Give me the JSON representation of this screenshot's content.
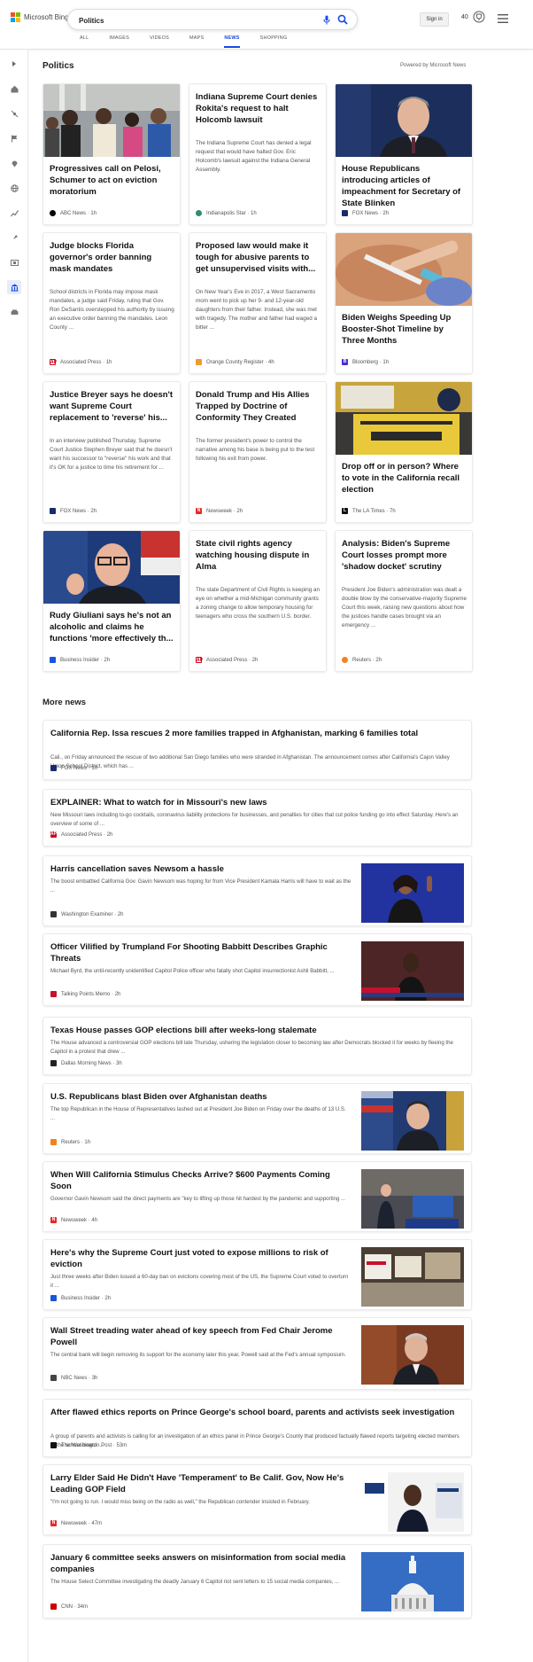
{
  "header": {
    "brand": "Microsoft Bing",
    "brand_colors": [
      "#f25022",
      "#7fba00",
      "#00a4ef",
      "#ffb900"
    ],
    "search_value": "Politics",
    "signin_label": "Sign in",
    "rewards_count": "40",
    "accent": "#174ae4"
  },
  "tabs": [
    "ALL",
    "IMAGES",
    "VIDEOS",
    "MAPS",
    "NEWS",
    "SHOPPING"
  ],
  "active_tab": "NEWS",
  "rail_icons": [
    "expand-icon",
    "home-icon",
    "unfollow-icon",
    "flag-icon",
    "location-icon",
    "globe-icon",
    "chart-icon",
    "rocket-icon",
    "film-icon",
    "politics-icon",
    "car-icon"
  ],
  "section": {
    "title": "Politics",
    "powered": "Powered by Microsoft News"
  },
  "cards": [
    {
      "title": "Progressives call on Pelosi, Schumer to act on eviction moratorium",
      "snippet": "",
      "source": "ABC News",
      "time": "1h",
      "logo_color": "#000000",
      "logo_text": "abc",
      "image": "protest"
    },
    {
      "title": "Indiana Supreme Court denies Rokita's request to halt Holcomb lawsuit",
      "snippet": "The Indiana Supreme Court has denied a legal request that would have halted Gov. Eric Holcomb's lawsuit against the Indiana General Assembly.",
      "source": "Indianapolis Star",
      "time": "1h",
      "logo_color": "#2b8f6f",
      "logo_text": "",
      "image": ""
    },
    {
      "title": "House Republicans introducing articles of impeachment for Secretary of State Blinken",
      "snippet": "",
      "source": "FOX News",
      "time": "2h",
      "logo_color": "#1a2b6d",
      "logo_text": "",
      "image": "blinken"
    },
    {
      "title": "Judge blocks Florida governor's order banning mask mandates",
      "snippet": "School districts in Florida may impose mask mandates, a judge said Friday, ruling that Gov. Ron DeSantis overstepped his authority by issuing an executive order banning the mandates. Leon County ...",
      "source": "Associated Press",
      "time": "1h",
      "logo_color": "#d0021b",
      "logo_text": "AP",
      "image": ""
    },
    {
      "title": "Proposed law would make it tough for abusive parents to get unsupervised visits with...",
      "snippet": "On New Year's Eve in 2017, a West Sacramento mom went to pick up her 9- and 12-year-old daughters from their father. Instead, she was met with tragedy. The mother and father had waged a bitter ...",
      "source": "Orange County Register",
      "time": "4h",
      "logo_color": "#f39a2e",
      "logo_text": "",
      "image": ""
    },
    {
      "title": "Biden Weighs Speeding Up Booster-Shot Timeline by Three Months",
      "snippet": "",
      "source": "Bloomberg",
      "time": "1h",
      "logo_color": "#4a2bd6",
      "logo_text": "B",
      "image": "vaccine"
    },
    {
      "title": "Justice Breyer says he doesn't want Supreme Court replacement to 'reverse' his...",
      "snippet": "In an interview published Thursday, Supreme Court Justice Stephen Breyer said that he doesn't want his successor to \"reverse\" his work and that it's OK for a justice to time his retirement for ...",
      "source": "FOX News",
      "time": "2h",
      "logo_color": "#1a2b6d",
      "logo_text": "",
      "image": ""
    },
    {
      "title": "Donald Trump and His Allies Trapped by Doctrine of Conformity They Created",
      "snippet": "The former president's power to control the narrative among his base is being put to the test following his exit from power.",
      "source": "Newsweek",
      "time": "2h",
      "logo_color": "#e42a2a",
      "logo_text": "N",
      "image": ""
    },
    {
      "title": "Drop off or in person? Where to vote in the California recall election",
      "snippet": "",
      "source": "The LA Times",
      "time": "7h",
      "logo_color": "#111111",
      "logo_text": "L",
      "image": "ballot"
    },
    {
      "title": "Rudy Giuliani says he's not an alcoholic and claims he functions 'more effectively th...",
      "snippet": "",
      "source": "Business Insider",
      "time": "2h",
      "logo_color": "#1a56db",
      "logo_text": "",
      "image": "giuliani"
    },
    {
      "title": "State civil rights agency watching housing dispute in Alma",
      "snippet": "The state Department of Civil Rights is keeping an eye on whether a mid-Michigan community grants a zoning change to allow temporary housing for teenagers who cross the southern U.S. border.",
      "source": "Associated Press",
      "time": "2h",
      "logo_color": "#d0021b",
      "logo_text": "AP",
      "image": ""
    },
    {
      "title": "Analysis: Biden's Supreme Court losses prompt more 'shadow docket' scrutiny",
      "snippet": "President Joe Biden's administration was dealt a double blow by the conservative-majority Supreme Court this week, raising new questions about how the justices handle cases brought via an emergency ...",
      "source": "Reuters",
      "time": "2h",
      "logo_color": "#f48120",
      "logo_text": "",
      "image": ""
    }
  ],
  "more_news": {
    "title": "More news",
    "items": [
      {
        "title": "California Rep. Issa rescues 2 more families trapped in Afghanistan, marking 6 families total",
        "snippet": "Cali., on Friday announced the rescue of two additional San Diego families who were stranded in Afghanistan. The announcement comes after California's Cajon Valley Union School District, which has ...",
        "source": "FOX News",
        "time": "1h",
        "logo_color": "#1a2b6d",
        "logo_text": "",
        "thumb": ""
      },
      {
        "title": "EXPLAINER: What to watch for in Missouri's new laws",
        "snippet": "New Missouri laws including to-go cocktails, coronavirus liability protections for businesses, and penalties for cities that cut police funding go into effect Saturday. Here's an overview of some of ...",
        "source": "Associated Press",
        "time": "2h",
        "logo_color": "#d0021b",
        "logo_text": "AP",
        "thumb": ""
      },
      {
        "title": "Harris cancellation saves Newsom a hassle",
        "snippet": "The boost embattled California Gov. Gavin Newsom was hoping for from Vice President Kamala Harris will have to wait as the ...",
        "source": "Washington Examiner",
        "time": "2h",
        "logo_color": "#333333",
        "logo_text": "",
        "thumb": "harris"
      },
      {
        "title": "Officer Vilified by Trumpland For Shooting Babbitt Describes Graphic Threats",
        "snippet": "Michael Byrd, the until-recently unidentified Capitol Police officer who fatally shot Capitol insurrectionist Ashli Babbitt, ...",
        "source": "Talking Points Memo",
        "time": "2h",
        "logo_color": "#c8102e",
        "logo_text": "",
        "thumb": "byrd"
      },
      {
        "title": "Texas House passes GOP elections bill after weeks-long stalemate",
        "snippet": "The House advanced a controversial GOP elections bill late Thursday, ushering the legislation closer to becoming law after Democrats blocked it for weeks by fleeing the Capitol in a protest that drew ...",
        "source": "Dallas Morning News",
        "time": "3h",
        "logo_color": "#222222",
        "logo_text": "",
        "thumb": ""
      },
      {
        "title": "U.S. Republicans blast Biden over Afghanistan deaths",
        "snippet": "The top Republican in the House of Representatives lashed out at President Joe Biden on Friday over the deaths of 13 U.S. ...",
        "source": "Reuters",
        "time": "1h",
        "logo_color": "#f48120",
        "logo_text": "",
        "thumb": "mccarthy"
      },
      {
        "title": "When Will California Stimulus Checks Arrive? $600 Payments Coming Soon",
        "snippet": "Governor Gavin Newsom said the direct payments are \"key to lifting up those hit hardest by the pandemic and supporting ...",
        "source": "Newsweek",
        "time": "4h",
        "logo_color": "#e42a2a",
        "logo_text": "N",
        "thumb": "newsom"
      },
      {
        "title": "Here's why the Supreme Court just voted to expose millions to risk of eviction",
        "snippet": "Just three weeks after Biden issued a 60-day ban on evictions covering most of the US, the Supreme Court voted to overturn it ...",
        "source": "Business Insider",
        "time": "2h",
        "logo_color": "#1a56db",
        "logo_text": "",
        "thumb": "eviction"
      },
      {
        "title": "Wall Street treading water ahead of key speech from Fed Chair Jerome Powell",
        "snippet": "The central bank will begin removing its support for the economy later this year, Powell said at the Fed's annual symposium.",
        "source": "NBC News",
        "time": "3h",
        "logo_color": "#444444",
        "logo_text": "",
        "thumb": "powell"
      },
      {
        "title": "After flawed ethics reports on Prince George's school board, parents and activists seek investigation",
        "snippet": "A group of parents and activists is calling for an investigation of an ethics panel in Prince George's County that produced factually flawed reports targeting elected members of the school board. ...",
        "source": "The Washington Post",
        "time": "53m",
        "logo_color": "#111111",
        "logo_text": "",
        "thumb": ""
      },
      {
        "title": "Larry Elder Said He Didn't Have 'Temperament' to Be Calif. Gov, Now He's Leading GOP Field",
        "snippet": "\"I'm not going to run. I would miss being on the radio as well,\" the Republican contender insisted in February.",
        "source": "Newsweek",
        "time": "47m",
        "logo_color": "#e42a2a",
        "logo_text": "N",
        "thumb": "elder"
      },
      {
        "title": "January 6 committee seeks answers on misinformation from social media companies",
        "snippet": "The House Select Committee investigating the deadly January 6 Capitol riot sent letters to 15 social media companies, ...",
        "source": "CNN",
        "time": "34m",
        "logo_color": "#cc0000",
        "logo_text": "",
        "thumb": "capitol"
      }
    ]
  }
}
